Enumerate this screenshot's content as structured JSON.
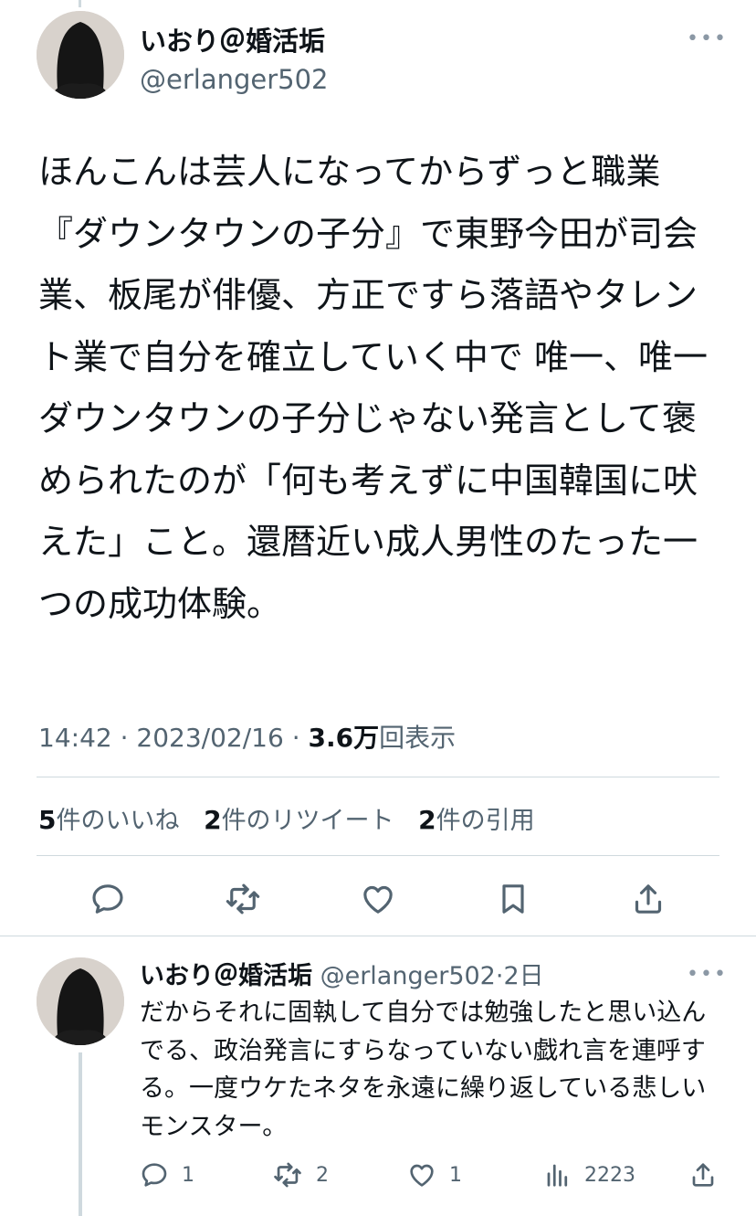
{
  "tweet": {
    "author_name": "いおり＠婚活垢",
    "author_handle": "@erlanger502",
    "more_label": "•••",
    "text": "ほんこんは芸人になってからずっと職業『ダウンタウンの子分』で東野今田が司会業、板尾が俳優、方正ですら落語やタレント業で自分を確立していく中で 唯一、唯一ダウンタウンの子分じゃない発言として褒められたのが「何も考えずに中国韓国に吠えた」こと。還暦近い成人男性のたった一つの成功体験。",
    "time": "14:42",
    "date": "2023/02/16",
    "views_count": "3.6",
    "views_unit": "万",
    "views_label": "回表示",
    "likes_count": "5",
    "likes_label": "件のいいね",
    "retweets_count": "2",
    "retweets_label": "件のリツイート",
    "quotes_count": "2",
    "quotes_label": "件の引用"
  },
  "actions": {
    "icons": [
      "reply-icon",
      "retweet-icon",
      "like-icon",
      "bookmark-icon",
      "share-icon"
    ]
  },
  "reply": {
    "author_name": "いおり＠婚活垢",
    "author_handle": "@erlanger502",
    "age": "2日",
    "more_label": "•••",
    "text": "だからそれに固執して自分では勉強したと思い込んでる、政治発言にすらなっていない戯れ言を連呼する。一度ウケたネタを永遠に繰り返している悲しいモンスター。",
    "reply_count": "1",
    "retweet_count": "2",
    "like_count": "1",
    "view_count": "2223"
  },
  "colors": {
    "text": "#0f1419",
    "secondary": "#536471",
    "divider": "#cfd9de"
  }
}
